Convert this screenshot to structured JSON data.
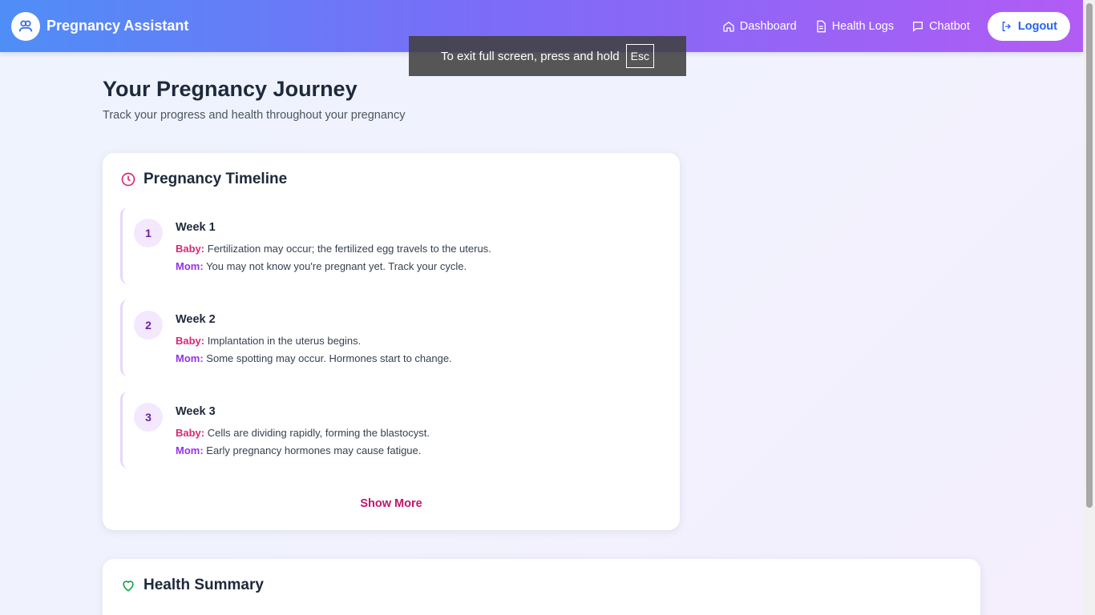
{
  "header": {
    "brand_title": "Pregnancy Assistant",
    "nav": [
      {
        "label": "Dashboard",
        "icon": "home-icon"
      },
      {
        "label": "Health Logs",
        "icon": "document-icon"
      },
      {
        "label": "Chatbot",
        "icon": "chat-icon"
      }
    ],
    "logout_label": "Logout"
  },
  "fullscreen_notice": {
    "text": "To exit full screen, press and hold",
    "key": "Esc"
  },
  "page": {
    "title": "Your Pregnancy Journey",
    "subtitle": "Track your progress and health throughout your pregnancy"
  },
  "timeline": {
    "title": "Pregnancy Timeline",
    "baby_label": "Baby:",
    "mom_label": "Mom:",
    "weeks": [
      {
        "number": "1",
        "title": "Week 1",
        "baby": "Fertilization may occur; the fertilized egg travels to the uterus.",
        "mom": "You may not know you're pregnant yet. Track your cycle."
      },
      {
        "number": "2",
        "title": "Week 2",
        "baby": "Implantation in the uterus begins.",
        "mom": "Some spotting may occur. Hormones start to change."
      },
      {
        "number": "3",
        "title": "Week 3",
        "baby": "Cells are dividing rapidly, forming the blastocyst.",
        "mom": "Early pregnancy hormones may cause fatigue."
      }
    ],
    "show_more_label": "Show More"
  },
  "health_summary": {
    "title": "Health Summary"
  },
  "colors": {
    "accent_pink": "#db2777",
    "accent_purple": "#9333ea",
    "header_gradient_start": "#4f8ef7",
    "header_gradient_end": "#b15cf5",
    "health_icon_green": "#16a34a"
  }
}
